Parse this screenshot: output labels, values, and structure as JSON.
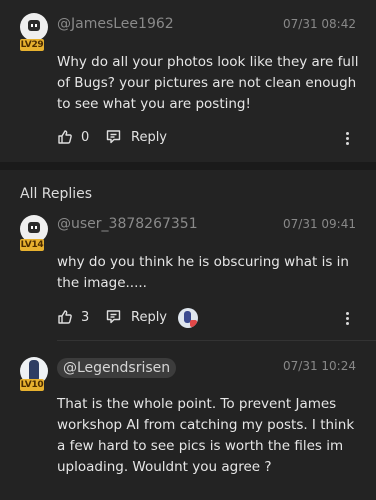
{
  "main_post": {
    "username": "@JamesLee1962",
    "level": "LV29",
    "time": "07/31 08:42",
    "content": "Why do all your photos look like they are full of Bugs? your pictures are not clean enough to see what you are posting!",
    "likes": "0",
    "reply_label": "Reply"
  },
  "all_replies_label": "All Replies",
  "replies": [
    {
      "username": "@user_3878267351",
      "level": "LV14",
      "time": "07/31 09:41",
      "content": "why do you think he is obscuring what is in the image.....",
      "likes": "3",
      "reply_label": "Reply"
    },
    {
      "username": "@Legendsrisen",
      "level": "LV10",
      "time": "07/31 10:24",
      "content": "That is the whole point. To prevent James workshop AI from catching my posts. I think a few hard to see pics is worth the files im uploading. Wouldnt you agree ?"
    }
  ],
  "colors": {
    "background": "#242424",
    "separator": "#1a1a1a",
    "level_badge": "#e7b12f",
    "meta_text": "#8a8a8a"
  },
  "icons": [
    "thumbs-up-icon",
    "reply-icon",
    "more-vertical-icon"
  ]
}
